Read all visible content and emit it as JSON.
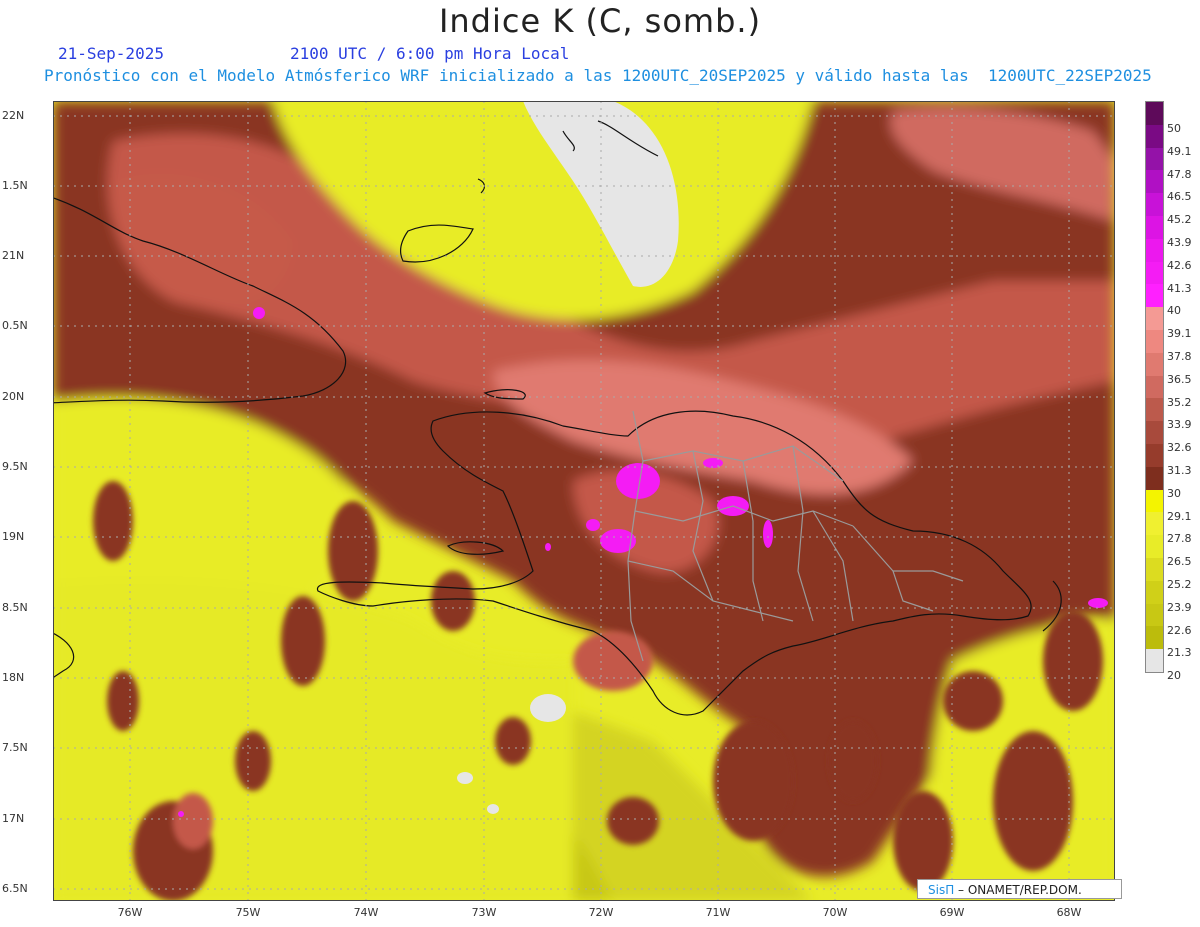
{
  "header": {
    "title": "Indice K (C, somb.)",
    "date": "21-Sep-2025",
    "time": "2100 UTC / 6:00 pm Hora Local",
    "forecast_note": "Pronóstico con el Modelo Atmósferico WRF inicializado a las 1200UTC_20SEP2025 y válido hasta las  1200UTC_22SEP2025"
  },
  "axes": {
    "lat_labels": [
      "22N",
      "1.5N",
      "21N",
      "0.5N",
      "20N",
      "9.5N",
      "19N",
      "8.5N",
      "18N",
      "7.5N",
      "17N",
      "6.5N"
    ],
    "lon_labels": [
      "76W",
      "75W",
      "74W",
      "73W",
      "72W",
      "71W",
      "70W",
      "69W",
      "68W"
    ]
  },
  "colorbar": {
    "labels": [
      "50",
      "49.1",
      "47.8",
      "46.5",
      "45.2",
      "43.9",
      "42.6",
      "41.3",
      "40",
      "39.1",
      "37.8",
      "36.5",
      "35.2",
      "33.9",
      "32.6",
      "31.3",
      "30",
      "29.1",
      "27.8",
      "26.5",
      "25.2",
      "23.9",
      "22.6",
      "21.3",
      "20"
    ],
    "colors": [
      "#5e0a5a",
      "#7a0a84",
      "#9412a8",
      "#b010c4",
      "#c812d8",
      "#dc14e4",
      "#ec18ee",
      "#f41cf4",
      "#ff20ff",
      "#f49a94",
      "#ee8880",
      "#e07a70",
      "#d06a60",
      "#bc5a4c",
      "#a84a3c",
      "#963c2c",
      "#7e2e1e",
      "#f4f400",
      "#f0f030",
      "#e8ec28",
      "#dcdc20",
      "#d0d018",
      "#c8c814",
      "#bcbc0c",
      "#e6e6e6"
    ]
  },
  "credit": {
    "brand": "SisΠ",
    "text": " – ONAMET/REP.DOM."
  }
}
